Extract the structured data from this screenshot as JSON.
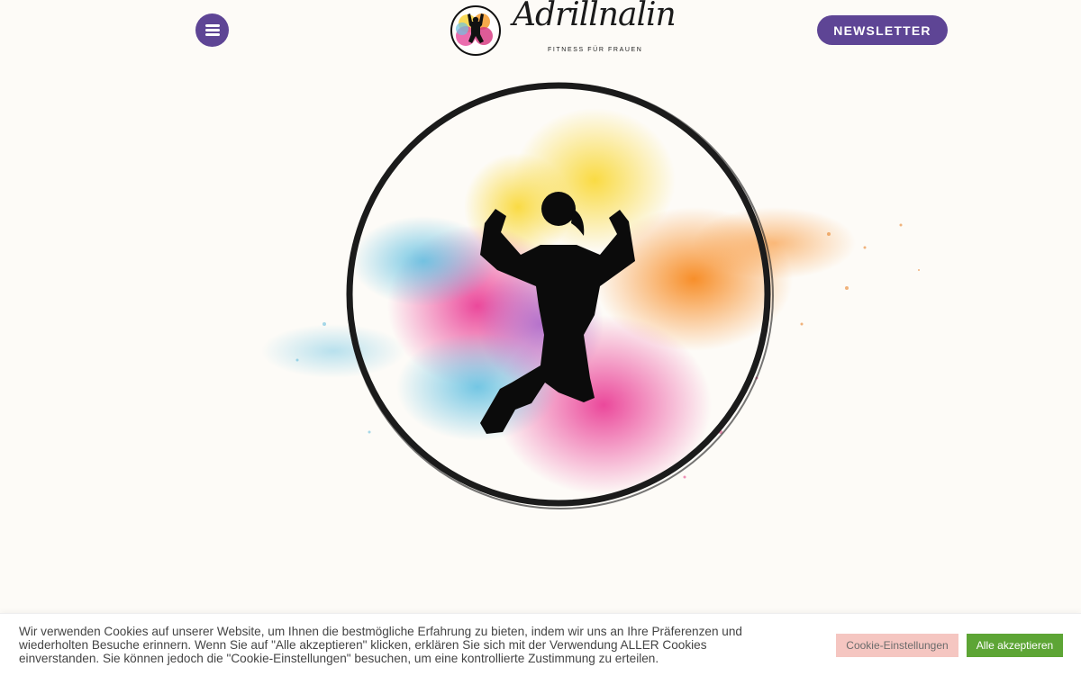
{
  "header": {
    "menu_icon": "hamburger-icon",
    "logo": {
      "script_text": "Adrillnalin",
      "tagline": "FITNESS FÜR FRAUEN"
    },
    "newsletter_label": "NEWSLETTER"
  },
  "colors": {
    "accent_purple": "#5e4595",
    "background": "#fdfbf7",
    "accept_green": "#5da535",
    "settings_pink": "#f5c6c1"
  },
  "hero": {
    "image": "jumping-woman-silhouette-color-splash"
  },
  "cookie_banner": {
    "text": "Wir verwenden Cookies auf unserer Website, um Ihnen die bestmögliche Erfahrung zu bieten, indem wir uns an Ihre Präferenzen und wiederholten Besuche erinnern. Wenn Sie auf \"Alle akzeptieren\" klicken, erklären Sie sich mit der Verwendung ALLER Cookies einverstanden. Sie können jedoch die \"Cookie-Einstellungen\" besuchen, um eine kontrollierte Zustimmung zu erteilen.",
    "settings_label": "Cookie-Einstellungen",
    "accept_label": "Alle akzeptieren"
  }
}
